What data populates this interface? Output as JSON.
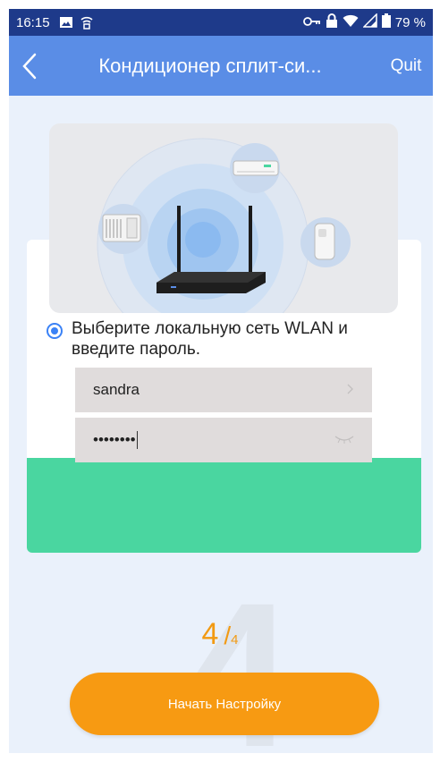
{
  "status_bar": {
    "time": "16:15",
    "battery": "79 %",
    "icons": [
      "image-icon",
      "wifi-signal-icon",
      "key-icon",
      "lock-icon",
      "wifi-icon",
      "cell-signal-icon",
      "battery-icon"
    ]
  },
  "navbar": {
    "title": "Кондиционер сплит-си...",
    "quit_label": "Quit",
    "back_icon": "chevron-left-icon"
  },
  "form": {
    "instruction": "Выберите локальную сеть WLAN и введите пароль.",
    "ssid_value": "sandra",
    "password_value": "••••••••"
  },
  "progress": {
    "current": "4",
    "total": "4",
    "background_number": "4"
  },
  "start_button_label": "Начать Настройку",
  "colors": {
    "navbar": "#5a8de6",
    "status_bar": "#1e3a8a",
    "background": "#eaf1fb",
    "green_band": "#4ad6a0",
    "accent_orange": "#f79a12"
  }
}
